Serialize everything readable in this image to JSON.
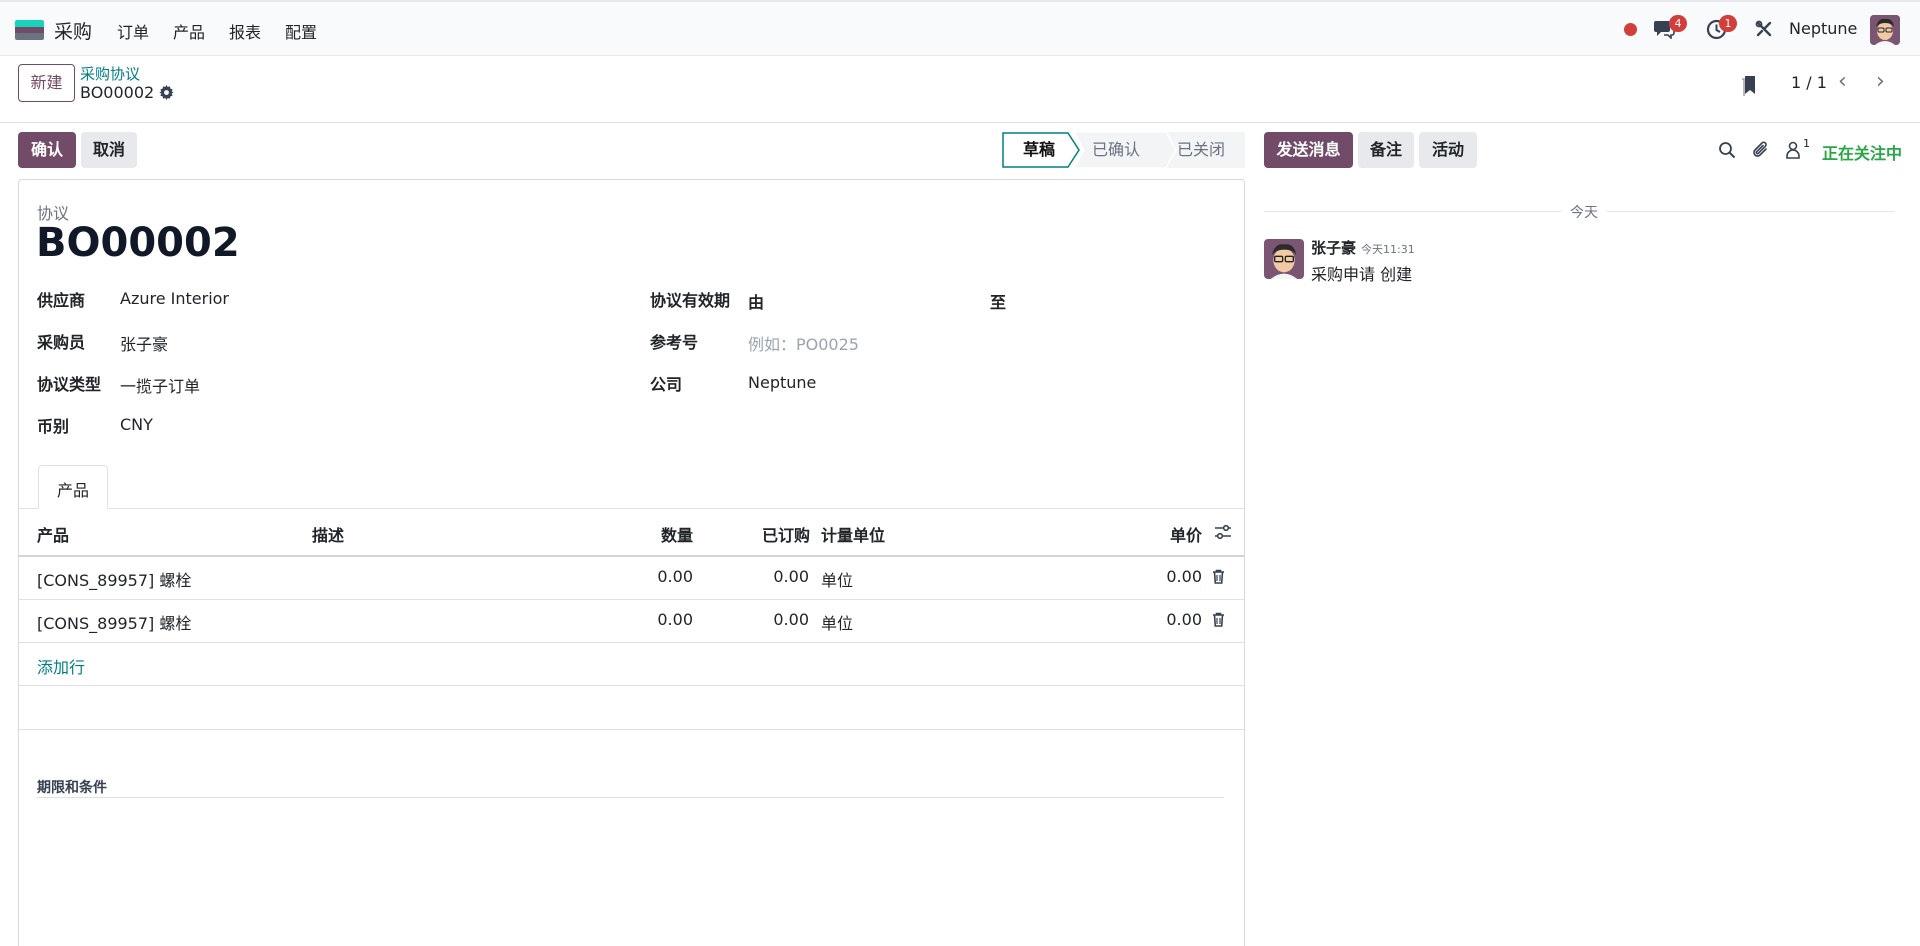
{
  "nav": {
    "app_name": "采购",
    "menu": [
      "订单",
      "产品",
      "报表",
      "配置"
    ],
    "messages_count": "4",
    "activities_count": "1",
    "company": "Neptune",
    "brand_colors": [
      "#1ad3bb",
      "#714b67",
      "#6b7280"
    ]
  },
  "control": {
    "new_label": "新建",
    "breadcrumb_parent": "采购协议",
    "record_name": "BO00002",
    "pager": "1 / 1"
  },
  "statusbar": {
    "confirm_label": "确认",
    "cancel_label": "取消",
    "stages": [
      "草稿",
      "已确认",
      "已关闭"
    ],
    "active_stage": "草稿"
  },
  "form": {
    "title_label": "协议",
    "title": "BO00002",
    "vendor_label": "供应商",
    "vendor": "Azure Interior",
    "buyer_label": "采购员",
    "buyer": "张子豪",
    "type_label": "协议类型",
    "type": "一揽子订单",
    "currency_label": "币别",
    "currency": "CNY",
    "validity_label": "协议有效期",
    "validity_from": "由",
    "validity_to": "至",
    "reference_label": "参考号",
    "reference_placeholder": "例如：PO0025",
    "company_label": "公司",
    "company": "Neptune",
    "tab_products": "产品",
    "add_line": "添加行",
    "terms_label": "期限和条件"
  },
  "table": {
    "headers": [
      "产品",
      "描述",
      "数量",
      "已订购",
      "计量单位",
      "单价"
    ],
    "rows": [
      {
        "product": "[CONS_89957] 螺栓",
        "description": "",
        "qty": "0.00",
        "ordered": "0.00",
        "uom": "单位",
        "price": "0.00"
      },
      {
        "product": "[CONS_89957] 螺栓",
        "description": "",
        "qty": "0.00",
        "ordered": "0.00",
        "uom": "单位",
        "price": "0.00"
      }
    ]
  },
  "chatter": {
    "send_message": "发送消息",
    "log_note": "备注",
    "activities": "活动",
    "followers_count": "1",
    "following": "正在关注中",
    "date_separator": "今天",
    "author": "张子豪",
    "time": "今天11:31",
    "message": "采购申请 创建",
    "accent_color": "#28a745"
  }
}
